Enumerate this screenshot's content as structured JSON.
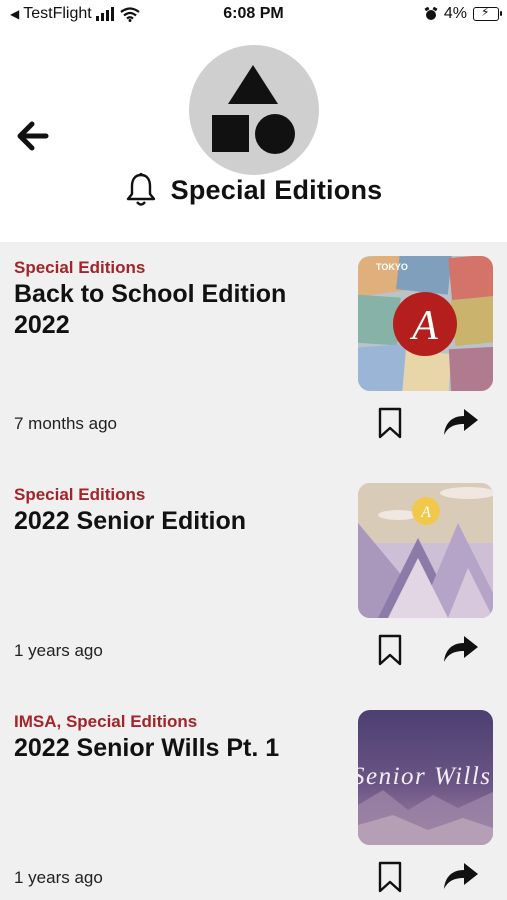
{
  "status_bar": {
    "carrier": "TestFlight",
    "time": "6:08 PM",
    "battery": "4%"
  },
  "header": {
    "title": "Special Editions"
  },
  "articles": [
    {
      "category": "Special Editions",
      "title": "Back to School Edition 2022",
      "time": "7 months ago"
    },
    {
      "category": "Special Editions",
      "title": "2022 Senior Edition",
      "time": "1 years ago"
    },
    {
      "category": "IMSA, Special Editions",
      "title": "2022 Senior Wills Pt. 1",
      "time": "1 years ago",
      "thumb_text": "Senior Wills"
    }
  ],
  "colors": {
    "category": "#a3252a",
    "feed_background": "#f0f0f0",
    "logo_background": "#cfcfcf"
  }
}
